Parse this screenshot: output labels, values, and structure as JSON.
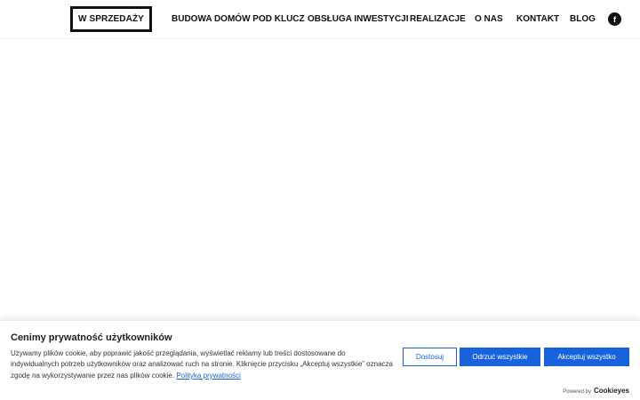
{
  "header": {
    "sale_button": "W SPRZEDAŻY",
    "nav": [
      {
        "label": "BUDOWA DOMÓW POD KLUCZ"
      },
      {
        "label": "OBSŁUGA INWESTYCJI"
      },
      {
        "label": "REALIZACJE"
      },
      {
        "label": "O NAS"
      },
      {
        "label": "KONTAKT"
      },
      {
        "label": "BLOG"
      }
    ],
    "social_icon": "facebook-icon"
  },
  "cookie": {
    "title": "Cenimy prywatność użytkowników",
    "text": "Używamy plików cookie, aby poprawić jakość przeglądania, wyświetlać reklamy lub treści dostosowane do indywidualnych potrzeb użytkowników oraz analizować ruch na stronie. Kliknięcie przycisku „Akceptuj wszystkie” oznacza zgodę na wykorzystywanie przez nas plików cookie.",
    "policy_link": "Polityka prywatności",
    "customize_label": "Dostosuj",
    "reject_label": "Odrzuć wszystkie",
    "accept_label": "Akceptuj wszystko",
    "powered_by": "Powered by",
    "powered_logo": "Cookieyes"
  },
  "colors": {
    "accent": "#1863dc",
    "text": "#111111"
  }
}
